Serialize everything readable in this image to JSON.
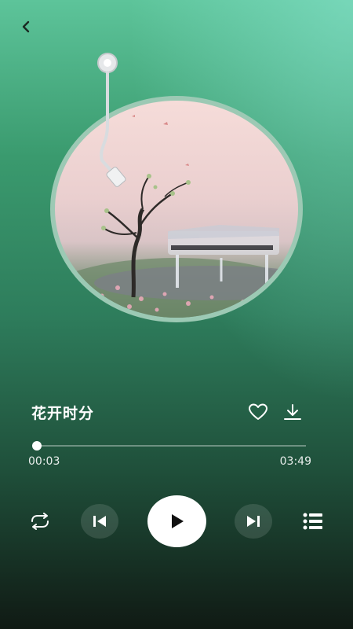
{
  "header": {
    "back_icon": "chevron-left-icon"
  },
  "song": {
    "title": "花开时分",
    "favorite_icon": "heart-outline-icon",
    "download_icon": "download-icon"
  },
  "progress": {
    "current_time": "00:03",
    "total_time": "03:49",
    "played_fraction": 0.013
  },
  "controls": {
    "loop_icon": "repeat-icon",
    "prev_icon": "skip-previous-icon",
    "play_icon": "play-icon",
    "next_icon": "skip-next-icon",
    "playlist_icon": "playlist-icon"
  },
  "colors": {
    "accent": "#ffffff",
    "background_top": "#5dc49a",
    "background_bottom": "#101a14",
    "disc_ring": "#9cc9b4"
  }
}
